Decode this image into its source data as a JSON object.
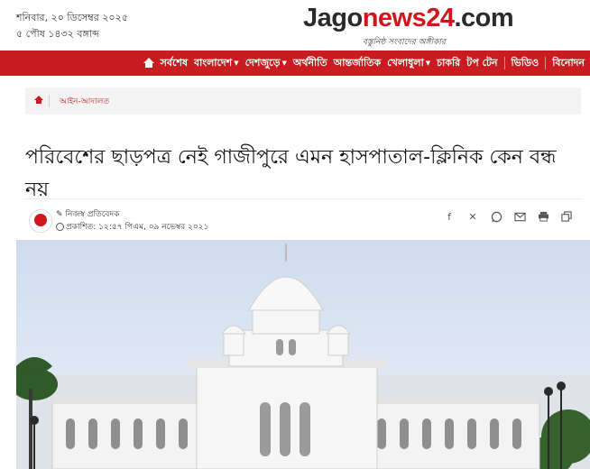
{
  "header": {
    "date_bn": "শনিবার, ২০ ডিসেম্বর ২০২৫",
    "date_bangla": "৫ পৌষ ১৪৩২ বঙ্গাব্দ",
    "logo_part1": "Jago",
    "logo_part2": "news",
    "logo_part3": "24",
    "logo_part4": ".com",
    "logo_tagline": "বস্তুনিষ্ঠ সংবাদের অঙ্গীকার"
  },
  "nav": {
    "items": [
      {
        "label": "সর্বশেষ"
      },
      {
        "label": "বাংলাদেশ"
      },
      {
        "label": "দেশজুড়ে"
      },
      {
        "label": "অর্থনীতি"
      },
      {
        "label": "আন্তর্জাতিক"
      },
      {
        "label": "খেলাধুলা"
      },
      {
        "label": "চাকরি"
      },
      {
        "label": "টপ টেন"
      },
      {
        "label": "ভিডিও"
      },
      {
        "label": "বিনোদন"
      }
    ]
  },
  "breadcrumb": {
    "category": "আইন-আদালত"
  },
  "article": {
    "headline": "পরিবেশের ছাড়পত্র নেই গাজীপুরে এমন হাসপাতাল-ক্লিনিক কেন বন্ধ নয়",
    "author": "নিজস্ব প্রতিবেদক",
    "published": "প্রকাশিত: ১২:৫৭ পিএম, ০৯ নভেম্বর ২০২১"
  },
  "share": {
    "icons": [
      "facebook-icon",
      "x-icon",
      "whatsapp-icon",
      "email-icon",
      "print-icon",
      "copy-icon"
    ]
  },
  "colors": {
    "brand_red": "#c81c21",
    "sky": "#dfe8f3"
  }
}
